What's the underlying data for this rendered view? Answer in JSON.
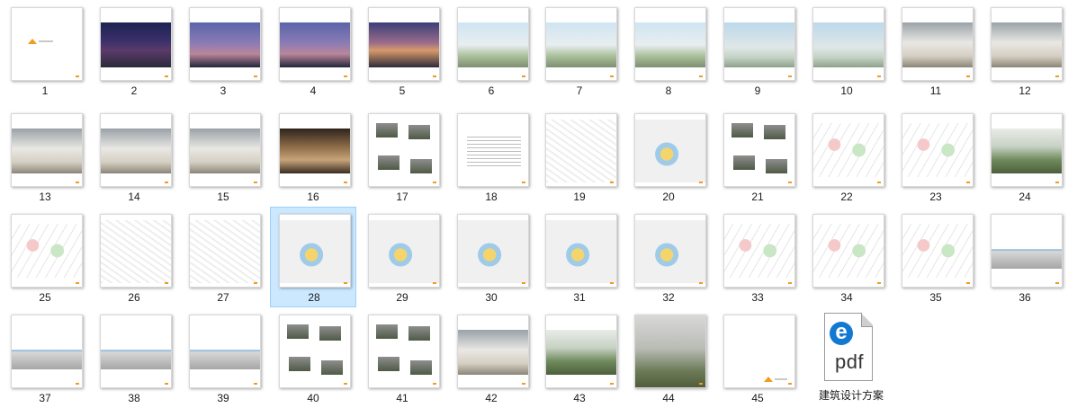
{
  "thumbnails": [
    {
      "label": "1",
      "style": "cover"
    },
    {
      "label": "2",
      "style": "night"
    },
    {
      "label": "3",
      "style": "dusk"
    },
    {
      "label": "4",
      "style": "dusk"
    },
    {
      "label": "5",
      "style": "sunset"
    },
    {
      "label": "6",
      "style": "day"
    },
    {
      "label": "7",
      "style": "day"
    },
    {
      "label": "8",
      "style": "day"
    },
    {
      "label": "9",
      "style": "dayg"
    },
    {
      "label": "10",
      "style": "dayg"
    },
    {
      "label": "11",
      "style": "interior"
    },
    {
      "label": "12",
      "style": "interior"
    },
    {
      "label": "13",
      "style": "interior"
    },
    {
      "label": "14",
      "style": "interior"
    },
    {
      "label": "15",
      "style": "interior"
    },
    {
      "label": "16",
      "style": "warm"
    },
    {
      "label": "17",
      "style": "collage"
    },
    {
      "label": "18",
      "style": "text"
    },
    {
      "label": "19",
      "style": "plan"
    },
    {
      "label": "20",
      "style": "planc"
    },
    {
      "label": "21",
      "style": "collage"
    },
    {
      "label": "22",
      "style": "diagram"
    },
    {
      "label": "23",
      "style": "diagram"
    },
    {
      "label": "24",
      "style": "green"
    },
    {
      "label": "25",
      "style": "diagram"
    },
    {
      "label": "26",
      "style": "plan"
    },
    {
      "label": "27",
      "style": "plan"
    },
    {
      "label": "28",
      "style": "planc"
    },
    {
      "label": "29",
      "style": "planc"
    },
    {
      "label": "30",
      "style": "planc"
    },
    {
      "label": "31",
      "style": "planc"
    },
    {
      "label": "32",
      "style": "planc"
    },
    {
      "label": "33",
      "style": "diagram"
    },
    {
      "label": "34",
      "style": "diagram"
    },
    {
      "label": "35",
      "style": "diagram"
    },
    {
      "label": "36",
      "style": "sect"
    },
    {
      "label": "37",
      "style": "sect"
    },
    {
      "label": "38",
      "style": "sect"
    },
    {
      "label": "39",
      "style": "sect"
    },
    {
      "label": "40",
      "style": "collage"
    },
    {
      "label": "41",
      "style": "collage"
    },
    {
      "label": "42",
      "style": "interior"
    },
    {
      "label": "43",
      "style": "green"
    },
    {
      "label": "44",
      "style": "model"
    },
    {
      "label": "45",
      "style": "cover-end"
    }
  ],
  "selected_label": "28",
  "pdf_file": {
    "icon_text": "pdf",
    "name": "建筑设计方案"
  },
  "colors": {
    "selection_fill": "#cce8ff",
    "selection_border": "#99d1ff",
    "brand_orange": "#f29b1c",
    "edge_blue": "#1279d3"
  }
}
